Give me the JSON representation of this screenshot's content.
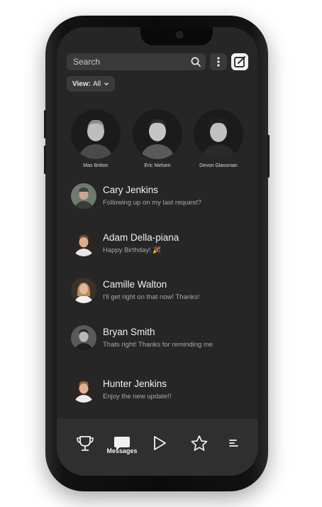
{
  "search": {
    "placeholder": "Search"
  },
  "view_filter": {
    "prefix": "View:",
    "value": "All"
  },
  "favorites": [
    {
      "name": "Max Britton"
    },
    {
      "name": "Eric Nielsen"
    },
    {
      "name": "Devon Glassman"
    }
  ],
  "messages": [
    {
      "name": "Cary Jenkins",
      "preview": "Following up on my last request?"
    },
    {
      "name": "Adam Della-piana",
      "preview": "Happy Birthday! 🎉"
    },
    {
      "name": "Camille Walton",
      "preview": "I'll get right on that now! Thanks!"
    },
    {
      "name": "Bryan Smith",
      "preview": "Thats right! Thanks for reminding me"
    },
    {
      "name": "Hunter Jenkins",
      "preview": "Enjoy the new update!!"
    }
  ],
  "tabbar": {
    "active_label": "Messages",
    "tabs": [
      {
        "icon": "trophy-icon"
      },
      {
        "icon": "chat-bubble-icon"
      },
      {
        "icon": "play-icon"
      },
      {
        "icon": "star-icon"
      },
      {
        "icon": "menu-lines-icon"
      }
    ]
  },
  "colors": {
    "screen_bg": "#262626",
    "accent": "#ffffff"
  }
}
